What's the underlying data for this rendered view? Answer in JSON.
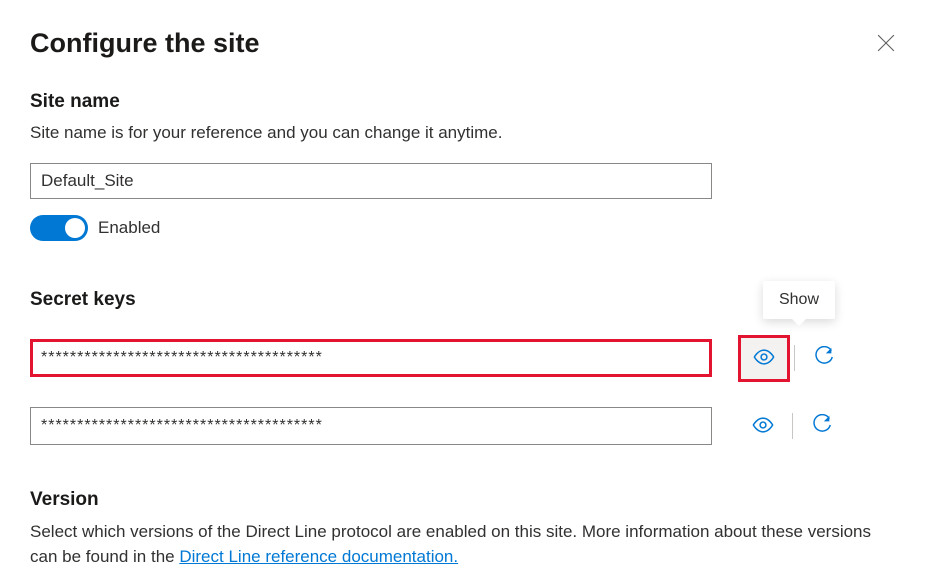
{
  "panel": {
    "title": "Configure the site"
  },
  "siteName": {
    "label": "Site name",
    "description": "Site name is for your reference and you can change it anytime.",
    "value": "Default_Site",
    "toggleLabel": "Enabled"
  },
  "secretKeys": {
    "label": "Secret keys",
    "tooltip": "Show",
    "key1": "***************************************",
    "key2": "***************************************"
  },
  "version": {
    "label": "Version",
    "descriptionPrefix": "Select which versions of the Direct Line protocol are enabled on this site. More information about these versions can be found in the ",
    "linkText": "Direct Line reference documentation."
  }
}
